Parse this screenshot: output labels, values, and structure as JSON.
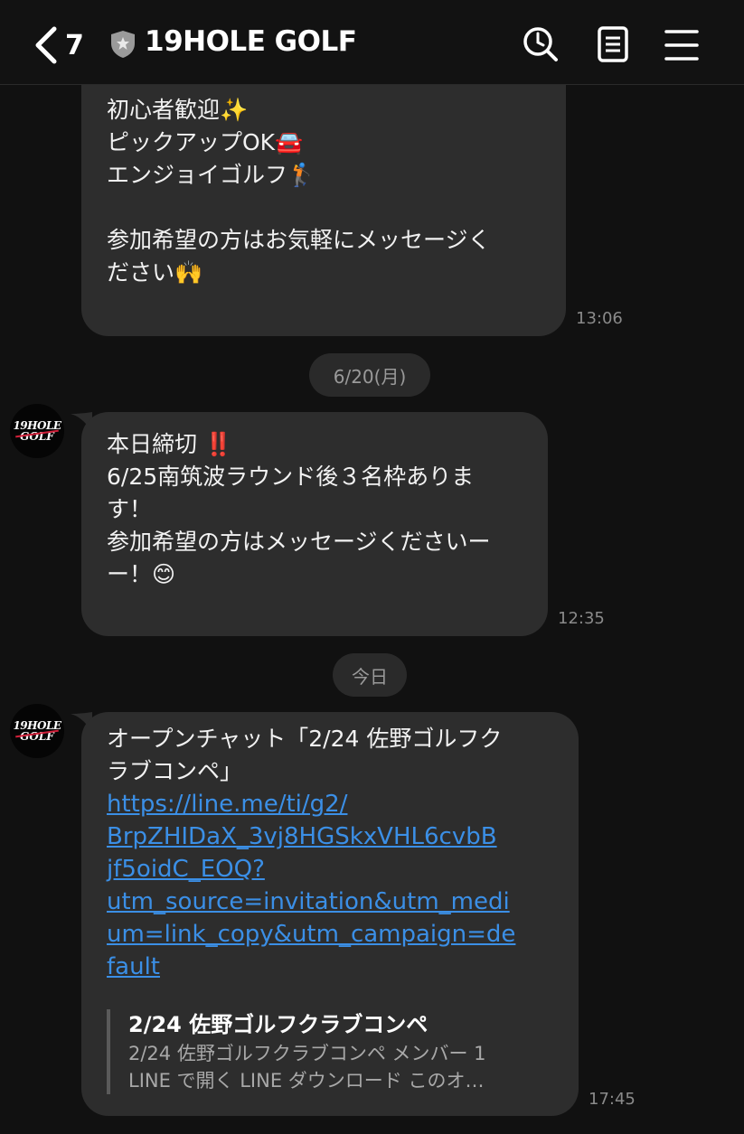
{
  "header": {
    "back_count": "7",
    "title": "19HOLE GOLF"
  },
  "avatar": {
    "line1": "19HOLE",
    "line2": "GOLF"
  },
  "messages": [
    {
      "lines": [
        "初心者歓迎✨",
        "ピックアップOK🚘",
        "エンジョイゴルフ🏌️",
        "",
        "",
        "参加希望の方はお気軽にメッセージく",
        "ださい🙌"
      ],
      "time": "13:06"
    },
    {
      "lines": [
        "本日締切 ‼️",
        "6/25南筑波ラウンド後３名枠ありま",
        "す！",
        "参加希望の方はメッセージくださいー",
        "ー！😊"
      ],
      "time": "12:35"
    },
    {
      "lines": [
        "オープンチャット「2/24 佐野ゴルフク",
        "ラブコンペ」"
      ],
      "link_lines": [
        "https://line.me/ti/g2/",
        "BrpZHIDaX_3vj8HGSkxVHL6cvbB",
        "jf5oidC_EOQ?",
        "utm_source=invitation&utm_medi",
        "um=link_copy&utm_campaign=de",
        "fault"
      ],
      "preview_title": "2/24 佐野ゴルフクラブコンペ",
      "preview_desc_1": "2/24 佐野ゴルフクラブコンペ メンバー 1",
      "preview_desc_2": "LINE で開く LINE ダウンロード このオ…",
      "time": "17:45"
    }
  ],
  "date_separators": [
    "6/20(月)",
    "今日"
  ]
}
